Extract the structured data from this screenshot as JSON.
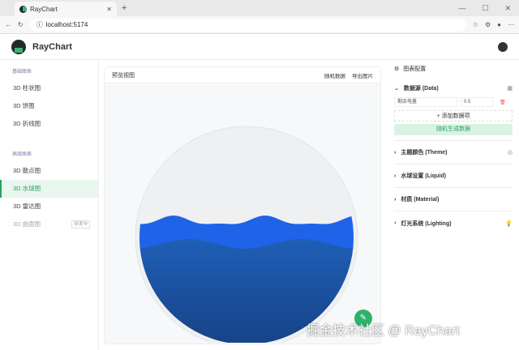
{
  "browser": {
    "tab_title": "RayChart",
    "url": "localhost:5174"
  },
  "app": {
    "title": "RayChart"
  },
  "sidebar": {
    "groups": [
      {
        "label": "基础图表",
        "items": [
          {
            "label": "3D 柱状图"
          },
          {
            "label": "3D 饼图"
          },
          {
            "label": "3D 折线图"
          }
        ]
      },
      {
        "label": "高级图表",
        "items": [
          {
            "label": "3D 散点图"
          },
          {
            "label": "3D 水球图"
          },
          {
            "label": "3D 雷达图"
          },
          {
            "label": "3D 曲面图",
            "badge": "研发中"
          }
        ]
      }
    ]
  },
  "preview": {
    "title": "预览视图",
    "random_label": "随机数据",
    "export_label": "导出图片",
    "liquid_level": 0.5,
    "liquid_color": "#1f63e8"
  },
  "config": {
    "title": "图表配置",
    "data_section": "数据源 (Data)",
    "data_item": {
      "name": "剩余电量",
      "value": "0.5"
    },
    "add_label": "添加数据项",
    "random_gen_label": "随机生成数据",
    "sections": [
      "主题颜色 (Theme)",
      "水球设置 (Liquid)",
      "材质 (Material)",
      "灯光系统 (Lighting)"
    ]
  },
  "watermark": "掘金技术社区 @ RayChart",
  "colors": {
    "accent": "#2d9f62"
  }
}
